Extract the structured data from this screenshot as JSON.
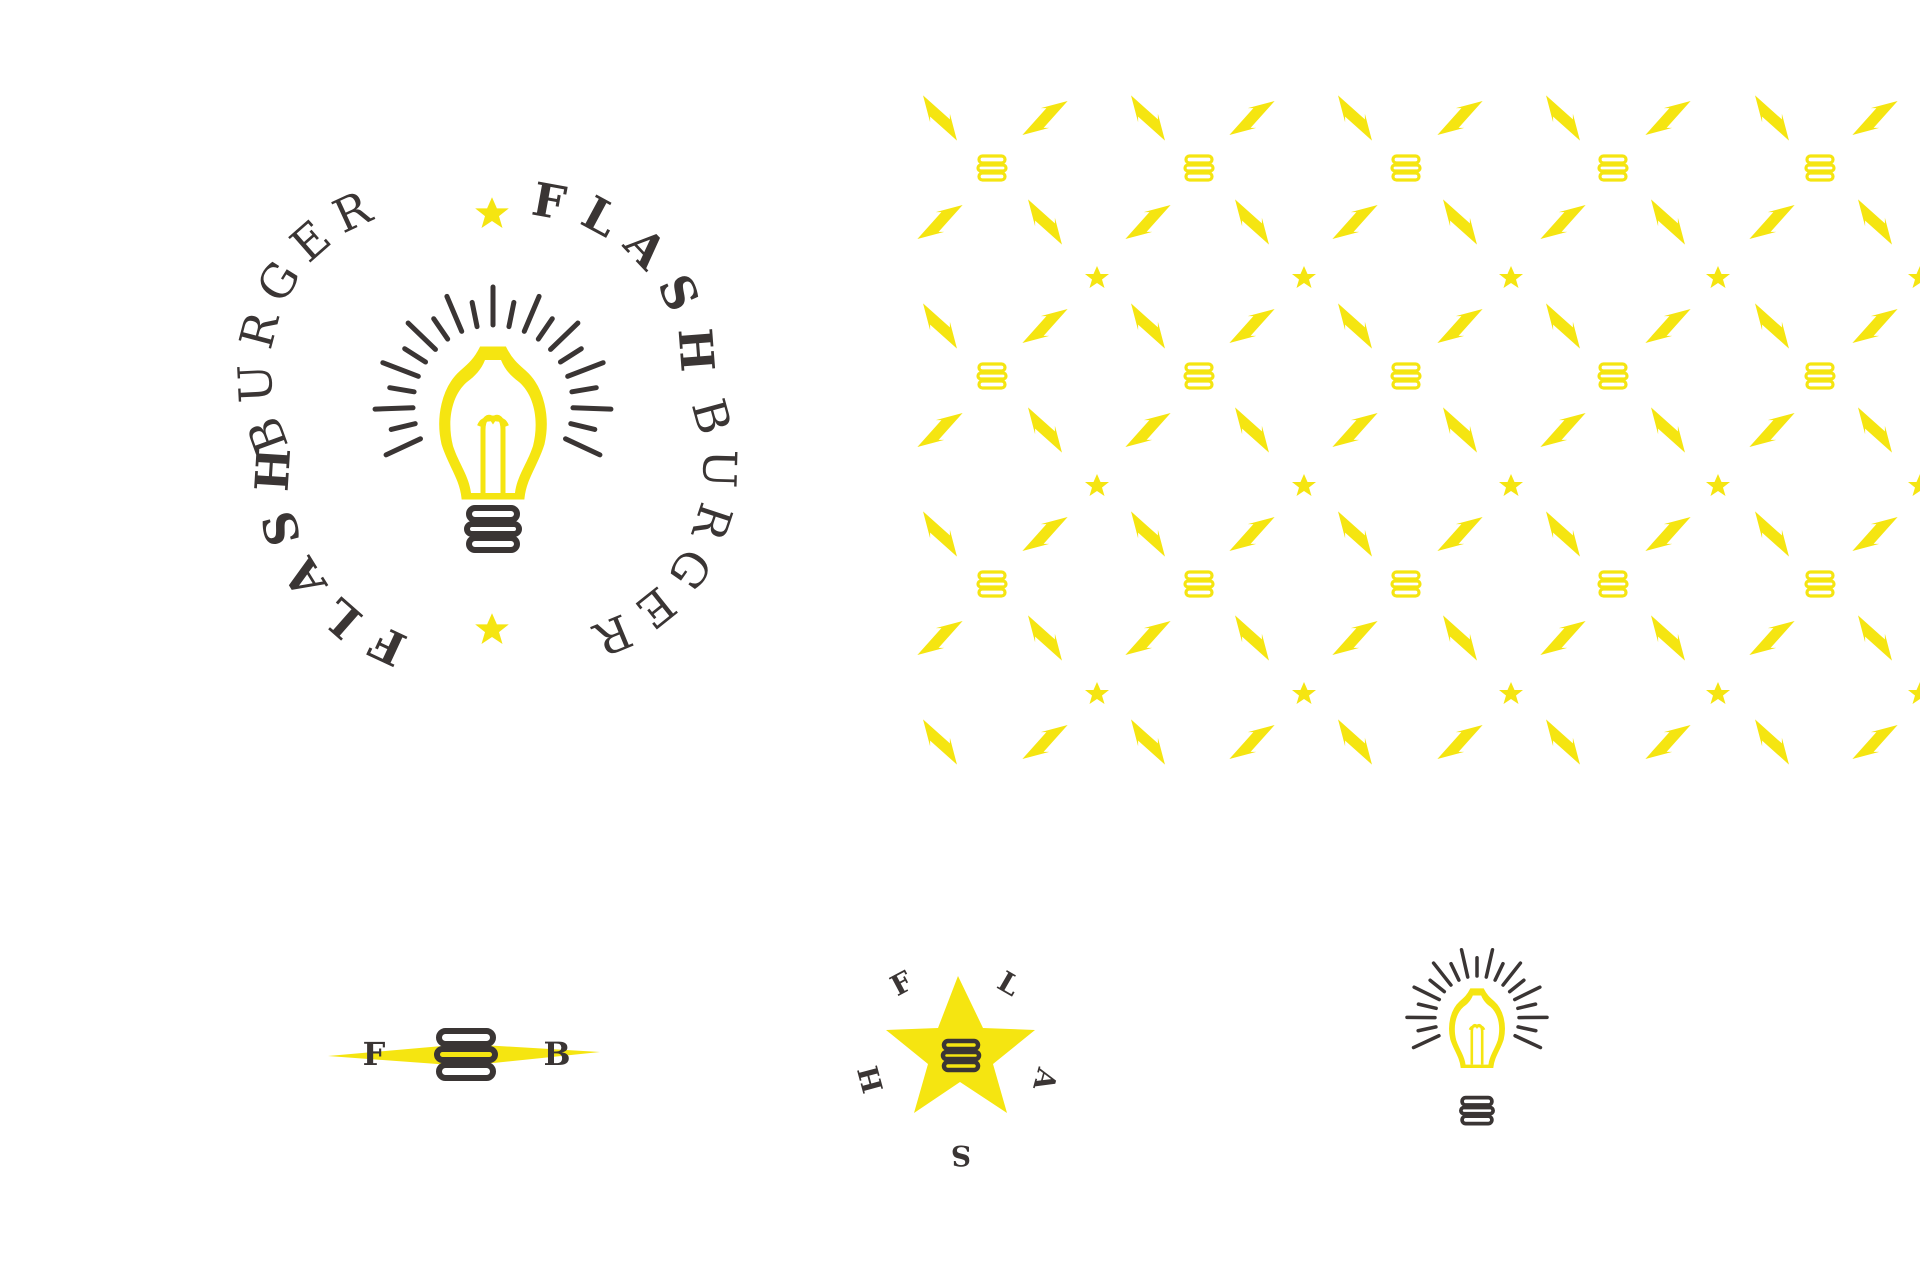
{
  "brand": {
    "word_a": "FLASH",
    "word_b": "BURGER",
    "initial_f": "F",
    "initial_b": "B",
    "star_letters": [
      "F",
      "L",
      "A",
      "S",
      "H"
    ]
  },
  "colors": {
    "yellow": "#f5e511",
    "charcoal": "#3a3534",
    "background": "#ffffff"
  },
  "icons": {
    "pattern": [
      "lightning-bolt-icon",
      "burger-icon",
      "star-icon"
    ],
    "badge_center": "lightbulb-icon",
    "mark_fb": "burger-icon",
    "mark_star": "star-icon",
    "mark_bulb": "lightbulb-icon"
  }
}
